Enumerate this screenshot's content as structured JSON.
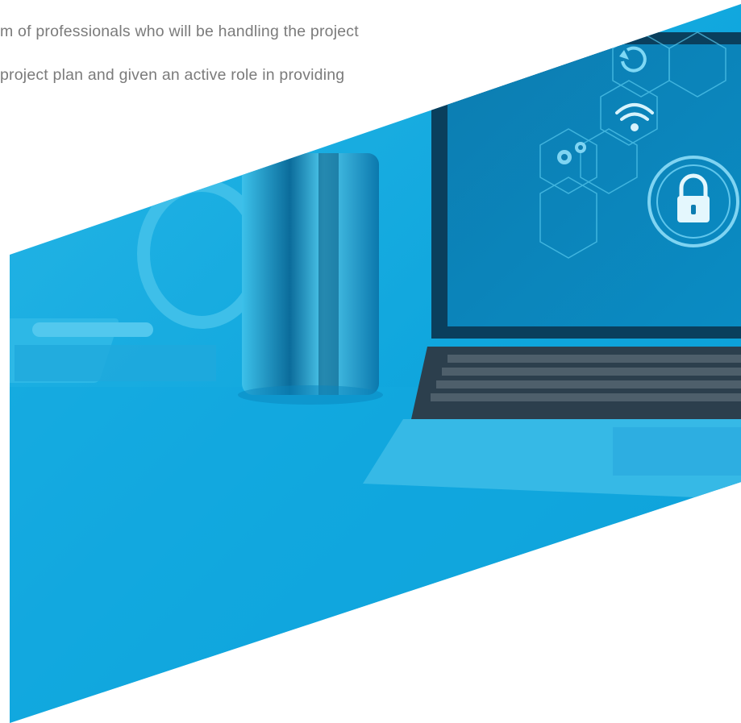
{
  "body_text": {
    "line_1": "m of professionals who will be handling the project",
    "line_2": "project plan and given an active role in providing"
  },
  "hero_image": {
    "description_icons": [
      "refresh-icon",
      "wifi-icon",
      "gears-icon",
      "padlock-icon"
    ],
    "colors": {
      "primary": "#0aa3dc",
      "light": "#2fbde8",
      "dark": "#0a5e86",
      "screen": "#0d7fb3"
    }
  }
}
